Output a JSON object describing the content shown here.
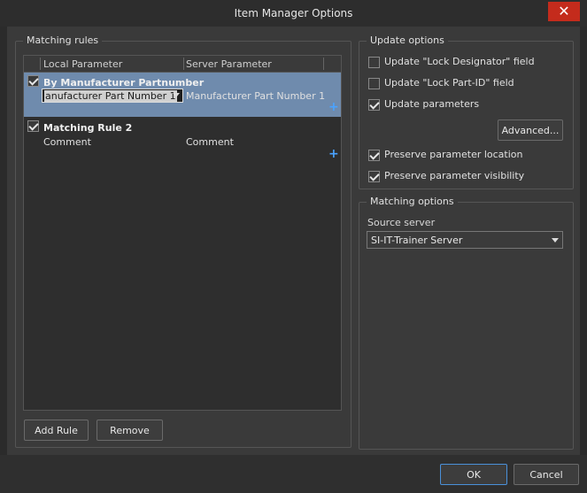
{
  "window": {
    "title": "Item Manager Options",
    "close_glyph": "✕"
  },
  "matching_rules": {
    "group_label": "Matching rules",
    "columns": [
      "Local Parameter",
      "Server Parameter"
    ],
    "rules": [
      {
        "name": "By Manufacturer Partnumber",
        "checked": true,
        "local": "anufacturer Part Number 1",
        "server": "Manufacturer Part Number 1"
      },
      {
        "name": "Matching Rule 2",
        "checked": true,
        "local": "Comment",
        "server": "Comment"
      }
    ],
    "add_rule_label": "Add Rule",
    "remove_label": "Remove"
  },
  "update_options": {
    "group_label": "Update options",
    "items": [
      {
        "label": "Update \"Lock Designator\" field",
        "checked": false
      },
      {
        "label": "Update \"Lock Part-ID\" field",
        "checked": false
      },
      {
        "label": "Update parameters",
        "checked": true
      }
    ],
    "advanced_label": "Advanced...",
    "preserve": [
      {
        "label": "Preserve parameter location",
        "checked": true
      },
      {
        "label": "Preserve parameter visibility",
        "checked": true
      }
    ]
  },
  "matching_options": {
    "group_label": "Matching options",
    "source_server_label": "Source server",
    "source_server_value": "SI-IT-Trainer Server"
  },
  "footer": {
    "ok_label": "OK",
    "cancel_label": "Cancel"
  },
  "icons": {
    "close": "close-icon",
    "add": "plus-icon",
    "dropdown": "chevron-down-icon"
  },
  "colors": {
    "selection": "#6f8bad",
    "accent": "#4a90d9",
    "close": "#c42b1c"
  }
}
